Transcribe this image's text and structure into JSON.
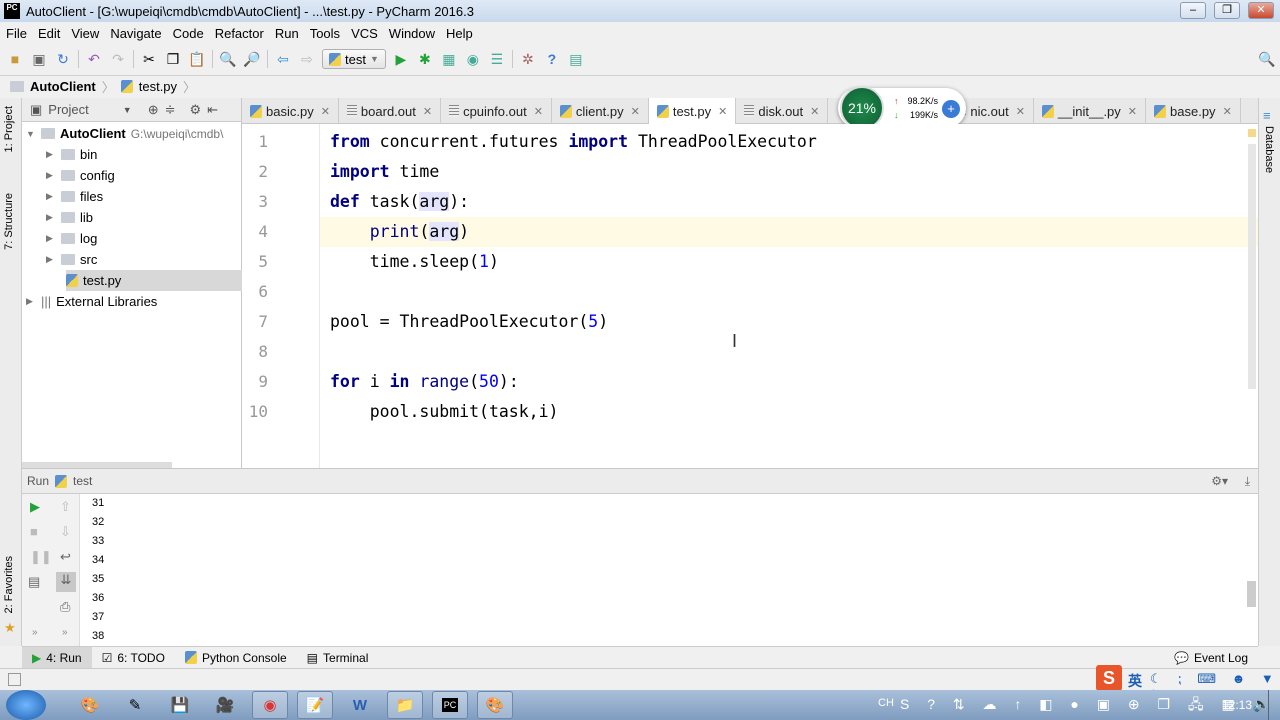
{
  "window": {
    "title": "AutoClient - [G:\\wupeiqi\\cmdb\\cmdb\\AutoClient] - ...\\test.py - PyCharm 2016.3",
    "app_icon": "PC"
  },
  "menu": [
    "File",
    "Edit",
    "View",
    "Navigate",
    "Code",
    "Refactor",
    "Run",
    "Tools",
    "VCS",
    "Window",
    "Help"
  ],
  "toolbar": {
    "run_config": "test"
  },
  "breadcrumb": [
    "AutoClient",
    "test.py"
  ],
  "side_tabs": {
    "project": "1: Project",
    "structure": "7: Structure",
    "favorites": "2: Favorites",
    "database": "Database"
  },
  "project": {
    "header": "Project",
    "root": {
      "name": "AutoClient",
      "path": "G:\\wupeiqi\\cmdb\\"
    },
    "items": [
      {
        "name": "bin",
        "type": "folder"
      },
      {
        "name": "config",
        "type": "folder"
      },
      {
        "name": "files",
        "type": "folder"
      },
      {
        "name": "lib",
        "type": "folder"
      },
      {
        "name": "log",
        "type": "folder"
      },
      {
        "name": "src",
        "type": "folder"
      },
      {
        "name": "test.py",
        "type": "file"
      }
    ],
    "external": "External Libraries"
  },
  "tabs": [
    {
      "label": "basic.py",
      "type": "py"
    },
    {
      "label": "board.out",
      "type": "txt"
    },
    {
      "label": "cpuinfo.out",
      "type": "txt"
    },
    {
      "label": "client.py",
      "type": "py"
    },
    {
      "label": "test.py",
      "type": "py",
      "active": true
    },
    {
      "label": "disk.out",
      "type": "txt"
    },
    {
      "label": "nic.out",
      "type": "txt"
    },
    {
      "label": "__init__.py",
      "type": "py"
    },
    {
      "label": "base.py",
      "type": "py"
    }
  ],
  "net_widget": {
    "cpu": "21%",
    "up": "98.2K/s",
    "down": "199K/s"
  },
  "editor": {
    "current_line": 4,
    "line_numbers": [
      "1",
      "2",
      "3",
      "4",
      "5",
      "6",
      "7",
      "8",
      "9",
      "10"
    ],
    "lines": [
      "from concurrent.futures import ThreadPoolExecutor",
      "import time",
      "def task(arg):",
      "    print(arg)",
      "    time.sleep(1)",
      "",
      "pool = ThreadPoolExecutor(5)",
      "",
      "for i in range(50):",
      "    pool.submit(task,i)"
    ]
  },
  "run": {
    "label": "Run",
    "config": "test",
    "output": [
      "31",
      "32",
      "33",
      "34",
      "35",
      "36",
      "37",
      "38"
    ]
  },
  "tool_tabs": [
    "4: Run",
    "6: TODO",
    "Python Console",
    "Terminal"
  ],
  "status": {
    "event_log": "Event Log"
  },
  "tray": {
    "lang": "CH",
    "ime": "英",
    "time": "12:13"
  }
}
